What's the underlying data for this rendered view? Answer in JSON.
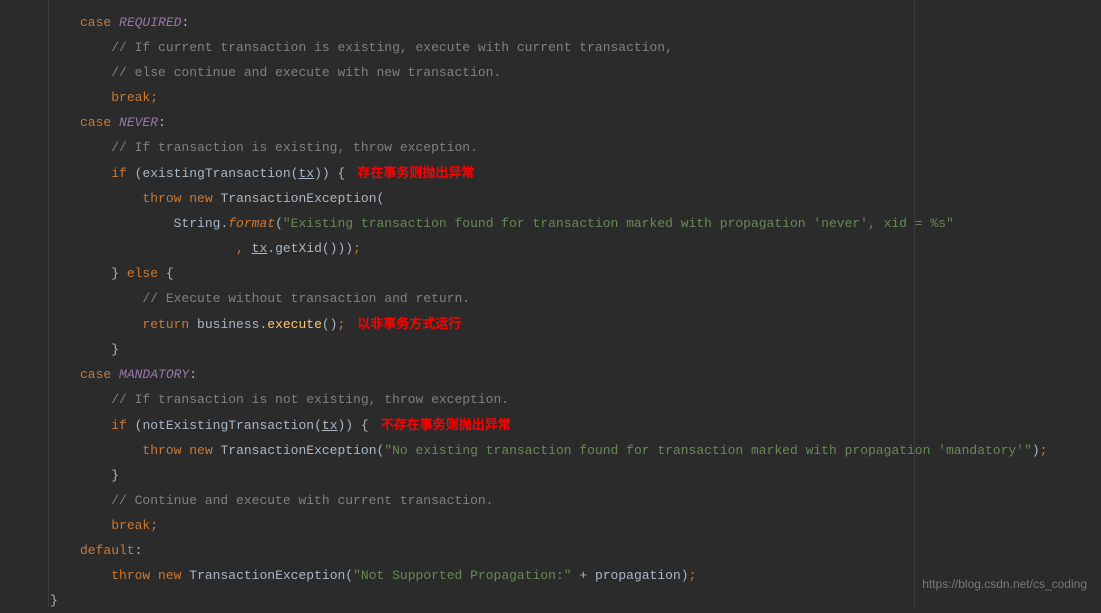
{
  "code": {
    "case1": "REQUIRED",
    "c1_l1": "// If current transaction is existing, execute with current transaction,",
    "c1_l2": "// else continue and execute with new transaction.",
    "break": "break",
    "case2": "NEVER",
    "c2_l1": "// If transaction is existing, throw exception.",
    "if": "if",
    "existingFn": "existingTransaction",
    "tx": "tx",
    "label1": "存在事务则抛出异常",
    "throw": "throw",
    "new": "new",
    "txException": "TransactionException",
    "stringCls": "String",
    "format": "format",
    "neverMsg": "\"Existing transaction found for transaction marked with propagation 'never', xid = %s\"",
    "getXid": ".getXid()))",
    "else": "else",
    "c2_l2": "// Execute without transaction and return.",
    "return": "return",
    "business": "business.",
    "execute": "execute",
    "label2": "以非事务方式运行",
    "case3": "MANDATORY",
    "c3_l1": "// If transaction is not existing, throw exception.",
    "notExistingFn": "notExistingTransaction",
    "label3": "不存在事务则抛出异常",
    "mandMsg": "\"No existing transaction found for transaction marked with propagation 'mandatory'\"",
    "c3_l2": "// Continue and execute with current transaction.",
    "default": "default",
    "notSupMsg": "\"Not Supported Propagation:\"",
    "propagation": "propagation"
  },
  "watermark": "https://blog.csdn.net/cs_coding"
}
